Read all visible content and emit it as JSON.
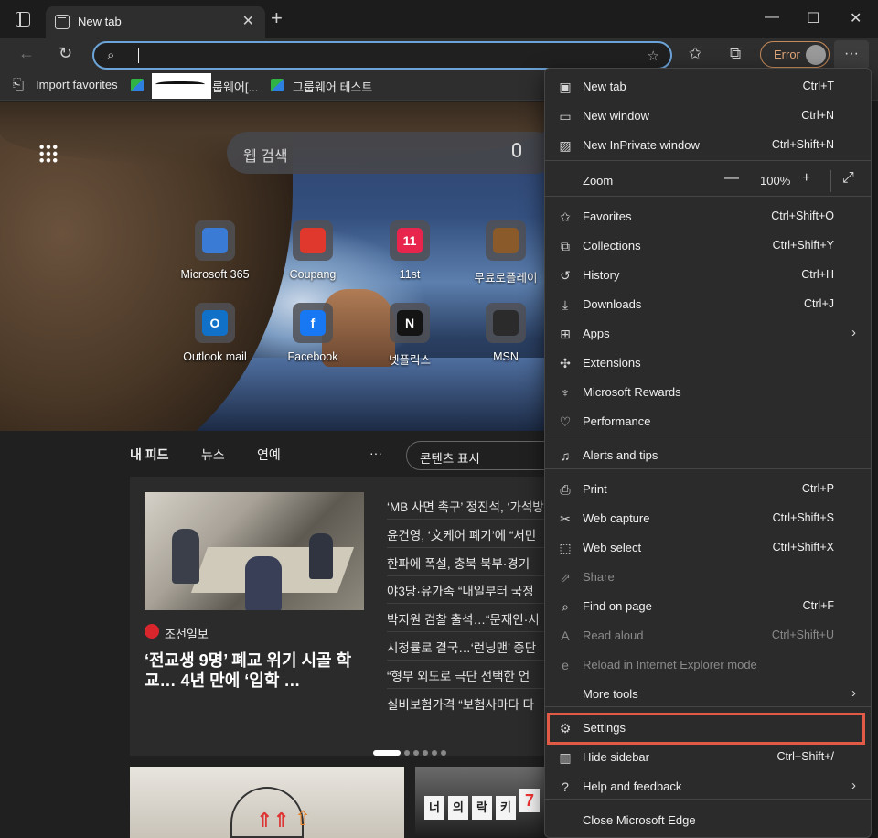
{
  "tab": {
    "title": "New tab",
    "close": "✕",
    "new": "+"
  },
  "window": {
    "minimize": "—",
    "maximize": "☐",
    "close": "✕"
  },
  "toolbar": {
    "back": "←",
    "refresh": "↻",
    "address_value": "",
    "error_label": "Error",
    "more": "···"
  },
  "favorites_bar": {
    "items": [
      {
        "label": "Import favorites"
      },
      {
        "label": "룹웨어[..."
      },
      {
        "label": "그룹웨어 테스트"
      }
    ]
  },
  "hero": {
    "search_placeholder": "웹 검색",
    "tiles": [
      {
        "label": "Microsoft 365",
        "color": "#3a7bd5",
        "glyph": ""
      },
      {
        "label": "Coupang",
        "color": "#e0382c",
        "glyph": ""
      },
      {
        "label": "11st",
        "color": "#e8264d",
        "glyph": "11"
      },
      {
        "label": "무료로플레이",
        "color": "#8a5a2a",
        "glyph": ""
      },
      {
        "label": "Outlook mail",
        "color": "#1171c9",
        "glyph": "O"
      },
      {
        "label": "Facebook",
        "color": "#1877f2",
        "glyph": "f"
      },
      {
        "label": "넷플릭스",
        "color": "#141414",
        "glyph": "N"
      },
      {
        "label": "MSN",
        "color": "#2b2b2b",
        "glyph": ""
      }
    ]
  },
  "feed": {
    "tabs": [
      "내 피드",
      "뉴스",
      "연예"
    ],
    "more": "···",
    "content_display": "콘텐츠 표시",
    "source": "조선일보",
    "headline": "‘전교생 9명’ 폐교 위기 시골 학교… 4년 만에 ‘입학 …",
    "headlines": [
      "‘MB 사면 촉구’ 정진석, ‘가석방’",
      "윤건영, ‘文케어 폐기’에 “서민",
      "한파에 폭설, 충북 북부·경기",
      "야3당·유가족 “내일부터 국정",
      "박지원 검찰 출석…“문재인·서",
      "시청률로 결국…‘런닝맨’ 중단",
      "“형부 외도로 극단 선택한 언",
      "실비보험가격 “보험사마다 다"
    ],
    "card3_signs": [
      "너",
      "의",
      "락",
      "키",
      "7"
    ]
  },
  "menu": {
    "items": [
      {
        "icon": "new-tab-icon",
        "glyph": "▣",
        "label": "New tab",
        "shortcut": "Ctrl+T"
      },
      {
        "icon": "new-window-icon",
        "glyph": "▭",
        "label": "New window",
        "shortcut": "Ctrl+N"
      },
      {
        "icon": "inprivate-icon",
        "glyph": "▨",
        "label": "New InPrivate window",
        "shortcut": "Ctrl+Shift+N"
      },
      {
        "icon": "zoom-icon",
        "glyph": "",
        "label": "Zoom",
        "shortcut": ""
      },
      {
        "icon": "favorites-icon",
        "glyph": "✩",
        "label": "Favorites",
        "shortcut": "Ctrl+Shift+O"
      },
      {
        "icon": "collections-icon",
        "glyph": "⧉",
        "label": "Collections",
        "shortcut": "Ctrl+Shift+Y"
      },
      {
        "icon": "history-icon",
        "glyph": "↺",
        "label": "History",
        "shortcut": "Ctrl+H"
      },
      {
        "icon": "downloads-icon",
        "glyph": "⤓",
        "label": "Downloads",
        "shortcut": "Ctrl+J"
      },
      {
        "icon": "apps-icon",
        "glyph": "⊞",
        "label": "Apps",
        "shortcut": ""
      },
      {
        "icon": "extensions-icon",
        "glyph": "✣",
        "label": "Extensions",
        "shortcut": ""
      },
      {
        "icon": "rewards-icon",
        "glyph": "♆",
        "label": "Microsoft Rewards",
        "shortcut": ""
      },
      {
        "icon": "performance-icon",
        "glyph": "♡",
        "label": "Performance",
        "shortcut": ""
      },
      {
        "icon": "alerts-icon",
        "glyph": "♫",
        "label": "Alerts and tips",
        "shortcut": ""
      },
      {
        "icon": "print-icon",
        "glyph": "⎙",
        "label": "Print",
        "shortcut": "Ctrl+P"
      },
      {
        "icon": "web-capture-icon",
        "glyph": "✂",
        "label": "Web capture",
        "shortcut": "Ctrl+Shift+S"
      },
      {
        "icon": "web-select-icon",
        "glyph": "⬚",
        "label": "Web select",
        "shortcut": "Ctrl+Shift+X"
      },
      {
        "icon": "share-icon",
        "glyph": "⇗",
        "label": "Share",
        "shortcut": ""
      },
      {
        "icon": "find-icon",
        "glyph": "⌕",
        "label": "Find on page",
        "shortcut": "Ctrl+F"
      },
      {
        "icon": "read-aloud-icon",
        "glyph": "A",
        "label": "Read aloud",
        "shortcut": "Ctrl+Shift+U"
      },
      {
        "icon": "ie-mode-icon",
        "glyph": "e",
        "label": "Reload in Internet Explorer mode",
        "shortcut": ""
      },
      {
        "icon": "more-tools-icon",
        "glyph": "",
        "label": "More tools",
        "shortcut": ""
      },
      {
        "icon": "settings-icon",
        "glyph": "⚙",
        "label": "Settings",
        "shortcut": ""
      },
      {
        "icon": "sidebar-icon",
        "glyph": "▥",
        "label": "Hide sidebar",
        "shortcut": "Ctrl+Shift+/"
      },
      {
        "icon": "help-icon",
        "glyph": "?",
        "label": "Help and feedback",
        "shortcut": ""
      },
      {
        "icon": "close-edge-icon",
        "glyph": "",
        "label": "Close Microsoft Edge",
        "shortcut": ""
      }
    ],
    "zoom": {
      "minus": "—",
      "value": "100%",
      "plus": "+",
      "fullscreen": "⤢"
    },
    "chevron": "›",
    "highlight_color": "#e05a45"
  }
}
